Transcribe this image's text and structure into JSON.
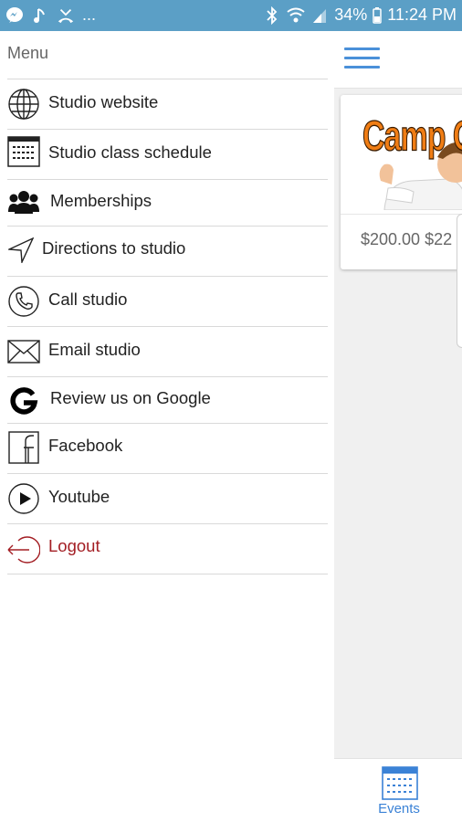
{
  "status_bar": {
    "notification_icons": [
      "messenger-icon",
      "music-note-icon",
      "missed-call-icon"
    ],
    "more": "...",
    "battery_percent": "34%",
    "time": "11:24 PM"
  },
  "drawer": {
    "title": "Menu",
    "items": [
      {
        "label": "Studio website",
        "icon": "globe-icon"
      },
      {
        "label": "Studio class schedule",
        "icon": "calendar-icon"
      },
      {
        "label": "Memberships",
        "icon": "users-icon"
      },
      {
        "label": "Directions to studio",
        "icon": "navigation-arrow-icon"
      },
      {
        "label": "Call studio",
        "icon": "phone-icon"
      },
      {
        "label": "Email studio",
        "icon": "envelope-icon"
      },
      {
        "label": "Review us on Google",
        "icon": "google-icon"
      },
      {
        "label": "Facebook",
        "icon": "facebook-icon"
      },
      {
        "label": "Youtube",
        "icon": "play-icon"
      },
      {
        "label": "Logout",
        "icon": "logout-icon"
      }
    ]
  },
  "main": {
    "event_card": {
      "image_text": "Camp Confi",
      "price": "$200.00 $22"
    },
    "bottom_nav": {
      "events_label": "Events"
    }
  },
  "colors": {
    "status_bar": "#5b9fc6",
    "accent": "#4a90d9",
    "logout": "#a31e24",
    "camp_title": "#f07d14"
  }
}
